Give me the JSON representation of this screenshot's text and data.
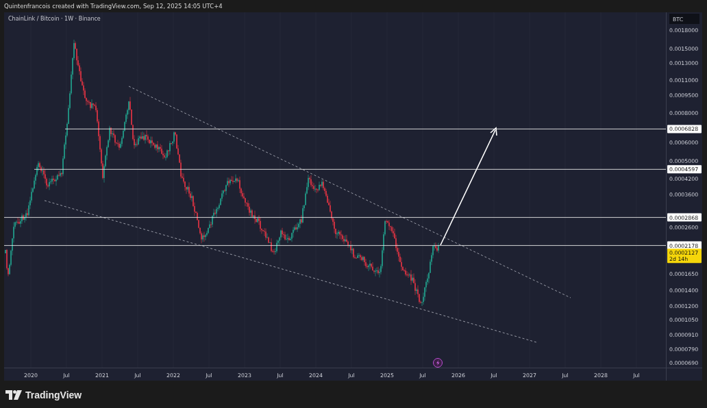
{
  "header": {
    "text": "Quintenfrancois created with TradingView.com, Sep 12, 2025 14:05 UTC+4"
  },
  "chart": {
    "legend": "ChainLink / Bitcoin · 1W · Binance",
    "currency": "BTC",
    "price_ticks": [
      "0.0018000",
      "0.0015000",
      "0.0013000",
      "0.0011000",
      "0.0009500",
      "0.0008000",
      "0.0006000",
      "0.0005000",
      "0.0004200",
      "0.0003600",
      "0.0002600",
      "0.0001650",
      "0.0001400",
      "0.0001200",
      "0.0001050",
      "0.0000910",
      "0.0000790",
      "0.0000690"
    ],
    "time_ticks": [
      "2020",
      "Jul",
      "2021",
      "Jul",
      "2022",
      "Jul",
      "2023",
      "Jul",
      "2024",
      "Jul",
      "2025",
      "Jul",
      "2026",
      "Jul",
      "2027",
      "Jul",
      "2028",
      "Jul"
    ],
    "levels": [
      {
        "label": "0.0006828"
      },
      {
        "label": "0.0004597"
      },
      {
        "label": "0.0002868"
      },
      {
        "label": "0.0002178"
      }
    ],
    "last_price": {
      "price": "0.0002127",
      "countdown": "2d 14h"
    }
  },
  "footer": {
    "logo_text": "TradingView"
  }
}
